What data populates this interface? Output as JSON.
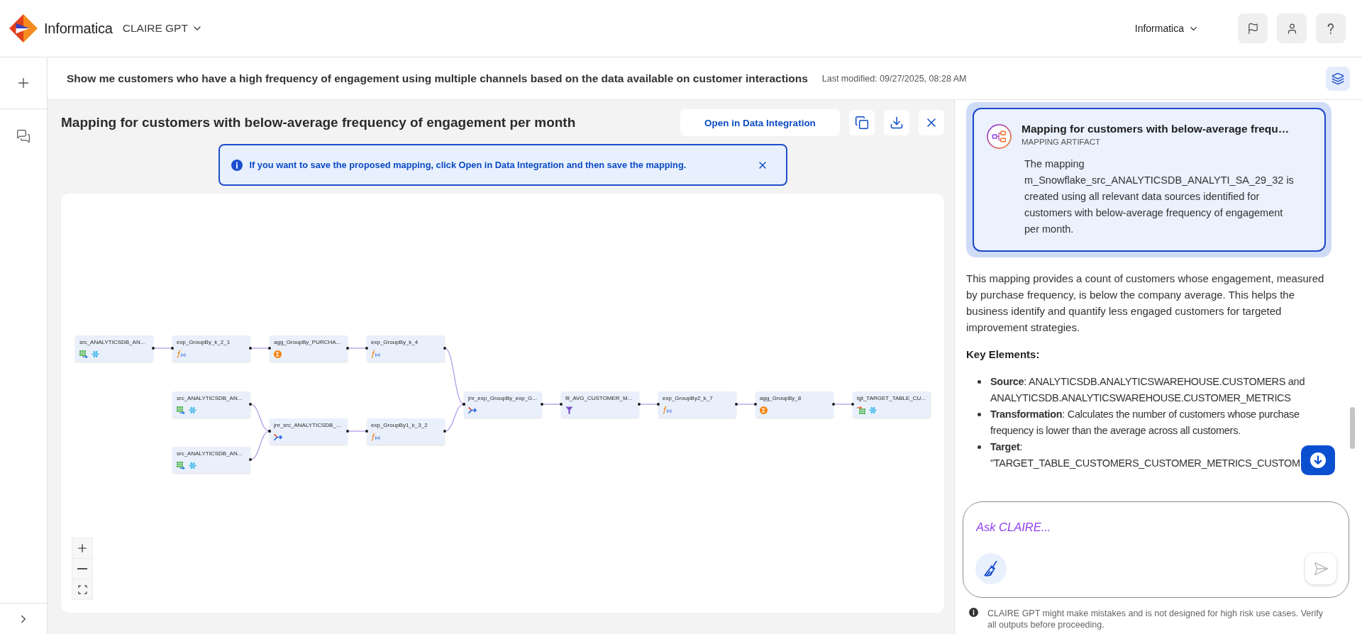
{
  "top_bar": {
    "brand": "Informatica",
    "product_menu": "CLAIRE GPT",
    "org_menu": "Informatica"
  },
  "question_bar": {
    "question": "Show me customers who have a high frequency of engagement using multiple channels based on the data available on customer interactions",
    "last_modified": "Last modified: 09/27/2025, 08:28 AM"
  },
  "mapping_panel": {
    "title": "Mapping for customers with below-average frequency of engagement per month",
    "open_button": "Open in Data Integration",
    "info_banner": "If you want to save the proposed mapping, click Open in Data Integration and then save the mapping.",
    "nodes": [
      {
        "label": "src_ANALYTICSDB_AN...",
        "kind": "source"
      },
      {
        "label": "exp_GroupBy_k_2_1",
        "kind": "expression"
      },
      {
        "label": "agg_GroupBy_PURCHA...",
        "kind": "aggregator"
      },
      {
        "label": "exp_GroupBy_k_4",
        "kind": "expression"
      },
      {
        "label": "src_ANALYTICSDB_AN...",
        "kind": "source"
      },
      {
        "label": "src_ANALYTICSDB_AN...",
        "kind": "source"
      },
      {
        "label": "jnr_src_ANALYTICSDB_...",
        "kind": "joiner"
      },
      {
        "label": "exp_GroupBy1_k_3_2",
        "kind": "expression"
      },
      {
        "label": "jnr_exp_GroupBy_exp_G...",
        "kind": "joiner"
      },
      {
        "label": "fil_AVG_CUSTOMER_M...",
        "kind": "filter"
      },
      {
        "label": "exp_GroupBy2_k_7",
        "kind": "expression"
      },
      {
        "label": "agg_GroupBy_8",
        "kind": "aggregator"
      },
      {
        "label": "tgt_TARGET_TABLE_CU...",
        "kind": "target"
      }
    ]
  },
  "chat_panel": {
    "artifact_card": {
      "title": "Mapping for customers with below-average frequ…",
      "type_label": "MAPPING ARTIFACT",
      "description": "The mapping m_Snowflake_src_ANALYTICSDB_ANALYTI_SA_29_32 is created using all relevant data sources identified for customers with below-average frequency of engagement per month."
    },
    "summary": "This mapping provides a count of customers whose engagement, measured by purchase frequency, is below the company average. This helps the business identify and quantify less engaged customers for targeted improvement strategies.",
    "key_elements_heading": "Key Elements:",
    "key_elements": [
      "**Source**: ANALYTICSDB.ANALYTICSWAREHOUSE.CUSTOMERS and ANALYTICSDB.ANALYTICSWAREHOUSE.CUSTOMER_METRICS",
      "**Transformation**: Calculates the number of customers whose purchase frequency is lower than the average across all customers.",
      "**Target**: \"TARGET_TABLE_CUSTOMERS_CUSTOMER_METRICS_CUSTOM"
    ],
    "input": {
      "placeholder": "Ask CLAIRE..."
    },
    "disclaimer": "CLAIRE GPT might make mistakes and is not designed for high risk use cases. Verify all outputs before proceeding."
  }
}
